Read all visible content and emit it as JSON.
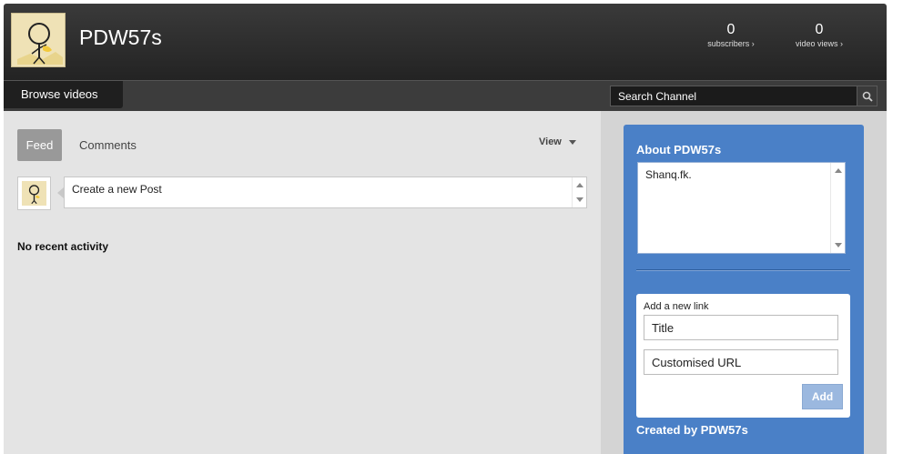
{
  "header": {
    "channel_name": "PDW57s",
    "stats": [
      {
        "count": "0",
        "label": "subscribers ›"
      },
      {
        "count": "0",
        "label": "video views ›"
      }
    ]
  },
  "navbar": {
    "browse_label": "Browse videos",
    "search_placeholder": "Search Channel"
  },
  "feed": {
    "tabs": [
      {
        "label": "Feed",
        "active": true
      },
      {
        "label": "Comments",
        "active": false
      }
    ],
    "view_label": "View",
    "post_placeholder": "Create a new Post",
    "empty_message": "No recent activity"
  },
  "sidebar": {
    "about_title": "About PDW57s",
    "about_text": "Shanq.fk.",
    "add_link_label": "Add a new link",
    "title_placeholder": "Title",
    "url_placeholder": "Customised URL",
    "add_button": "Add",
    "created_by": "Created by PDW57s"
  },
  "colors": {
    "header_bg": "#2c2c2c",
    "panel_blue": "#4a80c7",
    "feed_bg": "#e4e4e4",
    "sidebar_bg": "#d4d4d4"
  },
  "icons": {
    "search": "search-icon",
    "channel_avatar": "avatar-icon"
  }
}
